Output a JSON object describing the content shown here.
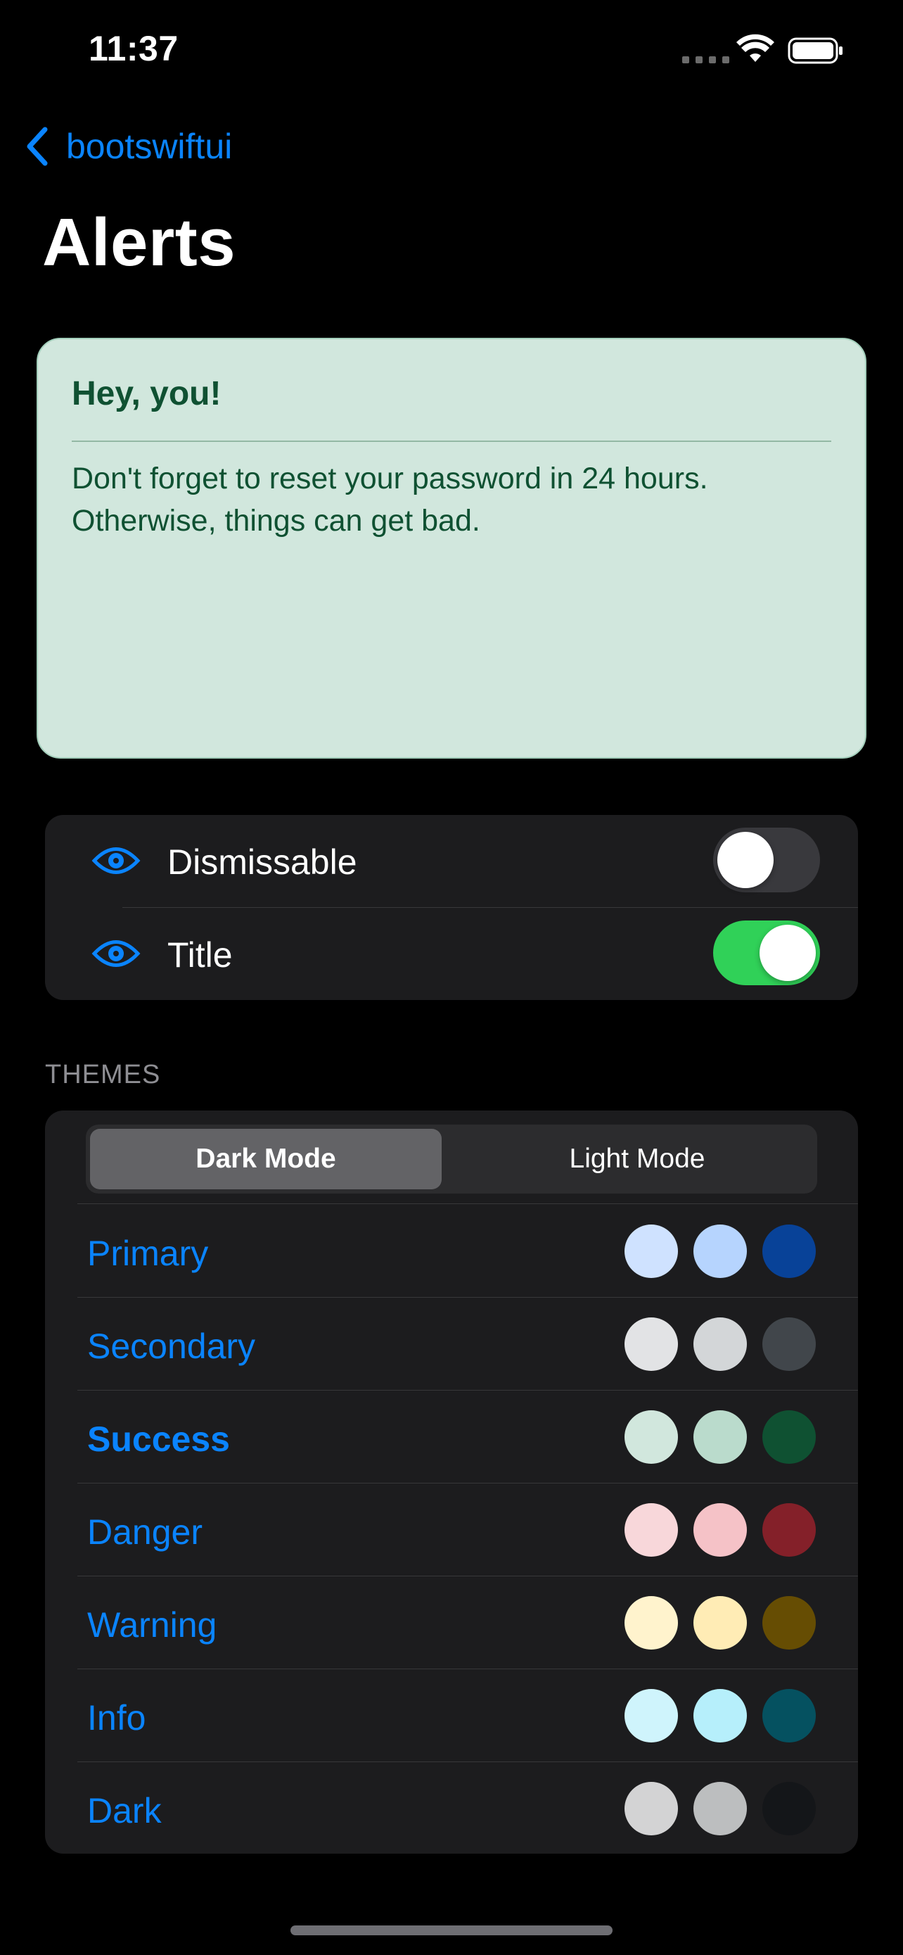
{
  "status_bar": {
    "time": "11:37"
  },
  "nav": {
    "back_label": "bootswiftui",
    "title": "Alerts"
  },
  "alert": {
    "title": "Hey, you!",
    "body": "Don't forget to reset your password in 24 hours. Otherwise, things can get bad.",
    "background": "#d1e7dd",
    "text_color": "#0f5132"
  },
  "toggles": [
    {
      "label": "Dismissable",
      "icon": "eye-icon",
      "on": false
    },
    {
      "label": "Title",
      "icon": "eye-icon",
      "on": true
    }
  ],
  "themes": {
    "header": "THEMES",
    "segments": [
      "Dark Mode",
      "Light Mode"
    ],
    "selected_segment": "Dark Mode",
    "rows": [
      {
        "label": "Primary",
        "selected": false,
        "colors": [
          "#cfe2ff",
          "#b6d4fe",
          "#084298"
        ]
      },
      {
        "label": "Secondary",
        "selected": false,
        "colors": [
          "#e2e3e5",
          "#d3d6d8",
          "#41464b"
        ]
      },
      {
        "label": "Success",
        "selected": true,
        "colors": [
          "#d1e7dd",
          "#badbcc",
          "#0f5132"
        ]
      },
      {
        "label": "Danger",
        "selected": false,
        "colors": [
          "#f8d7da",
          "#f5c2c7",
          "#842029"
        ]
      },
      {
        "label": "Warning",
        "selected": false,
        "colors": [
          "#fff3cd",
          "#ffecb5",
          "#664d03"
        ]
      },
      {
        "label": "Info",
        "selected": false,
        "colors": [
          "#cff4fc",
          "#b6effb",
          "#055160"
        ]
      },
      {
        "label": "Dark",
        "selected": false,
        "colors": [
          "#d3d3d4",
          "#bcbebf",
          "#141619"
        ]
      }
    ]
  },
  "colors": {
    "accent": "#0a84ff",
    "switch_on": "#30d158",
    "group_background": "#1c1c1e"
  }
}
